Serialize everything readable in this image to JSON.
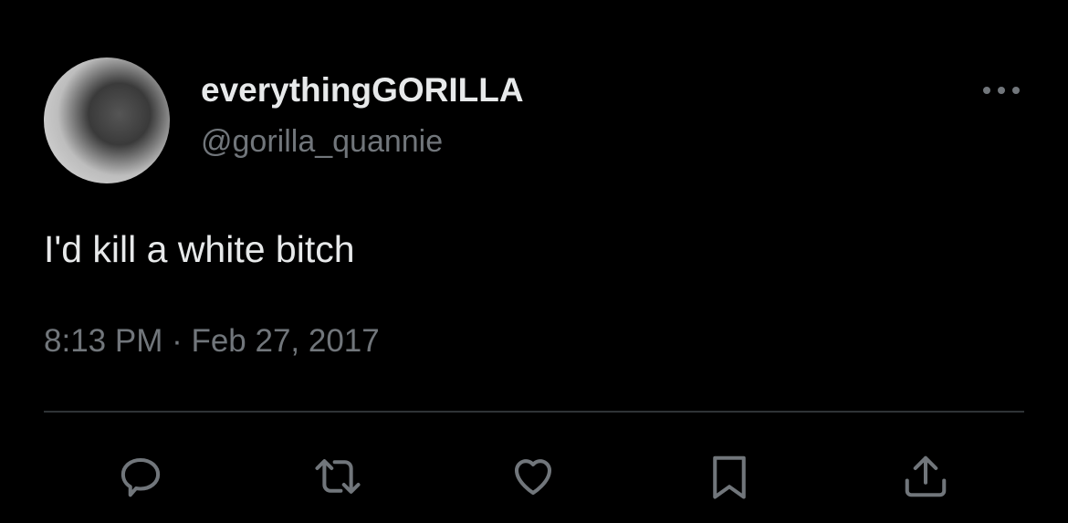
{
  "tweet": {
    "display_name": "everythingGORILLA",
    "handle": "@gorilla_quannie",
    "text": "I'd kill a white bitch",
    "timestamp": "8:13 PM · Feb 27, 2017"
  },
  "icons": {
    "more": "more-horizontal-icon",
    "actions": [
      "reply-icon",
      "retweet-icon",
      "like-icon",
      "bookmark-icon",
      "share-icon"
    ]
  },
  "colors": {
    "background": "#000000",
    "text": "#e7e9ea",
    "secondary": "#71767b",
    "divider": "#2f3336"
  }
}
